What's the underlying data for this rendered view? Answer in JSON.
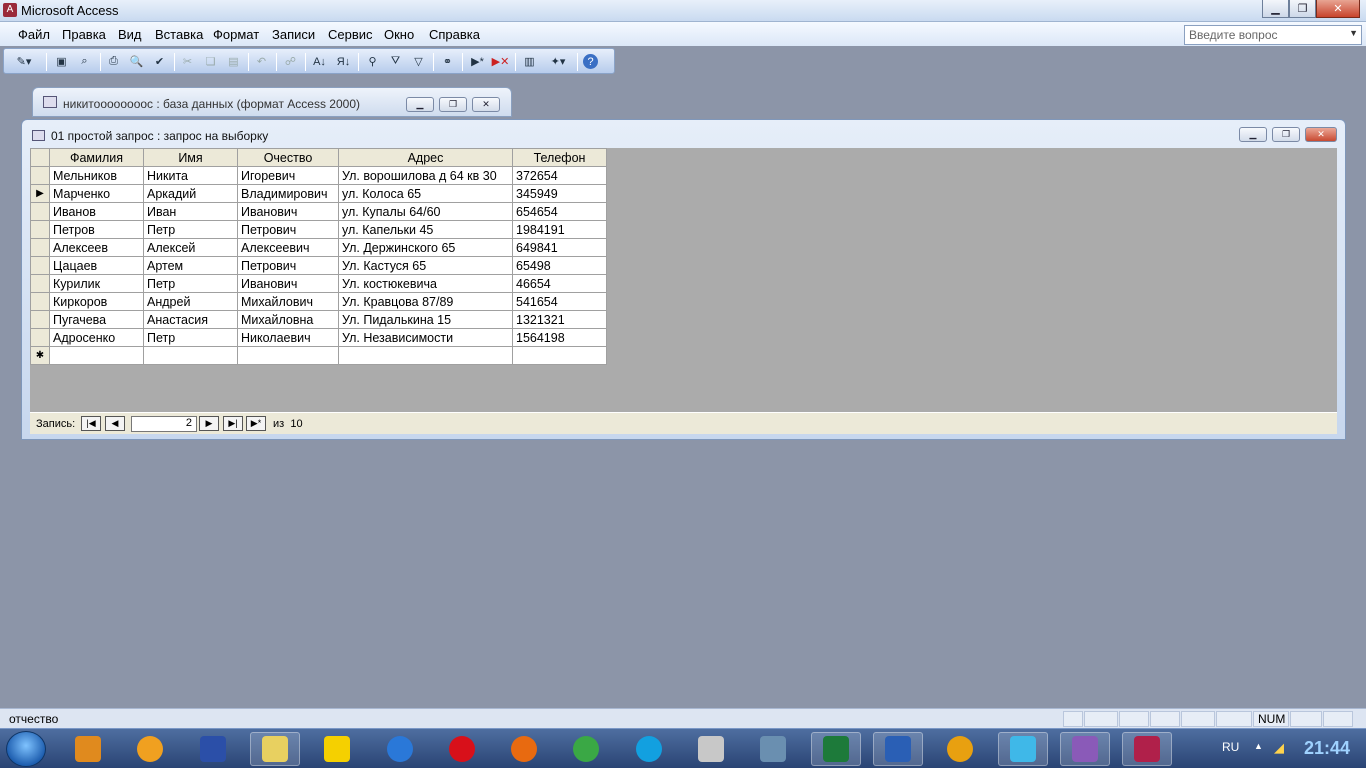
{
  "app": {
    "title": "Microsoft Access"
  },
  "menu": [
    "Файл",
    "Правка",
    "Вид",
    "Вставка",
    "Формат",
    "Записи",
    "Сервис",
    "Окно",
    "Справка"
  ],
  "ask_box": {
    "placeholder": "Введите вопрос"
  },
  "toolbar_icons": [
    "view-icon",
    "save-icon",
    "search-db-icon",
    "print-icon",
    "print-preview-icon",
    "spelling-icon",
    "cut-icon",
    "copy-icon",
    "paste-icon",
    "undo-icon",
    "hyperlink-icon",
    "sort-asc-icon",
    "sort-desc-icon",
    "filter-selection-icon",
    "filter-form-icon",
    "apply-filter-icon",
    "find-icon",
    "new-record-icon",
    "delete-record-icon",
    "database-window-icon",
    "new-object-icon",
    "help-icon"
  ],
  "db_window": {
    "title": "никитоооооооос : база данных (формат Access 2000)"
  },
  "query_window": {
    "title": "01 простой запрос : запрос на выборку"
  },
  "datasheet": {
    "columns": [
      "Фамилия",
      "Имя",
      "Очество",
      "Адрес",
      "Телефон"
    ],
    "rows": [
      [
        "Мельников",
        "Никита",
        "Игоревич",
        "Ул. ворошилова д 64 кв 30",
        "372654"
      ],
      [
        "Марченко",
        "Аркадий",
        "Владимирович",
        "ул. Колоса 65",
        "345949"
      ],
      [
        "Иванов",
        "Иван",
        "Иванович",
        "ул. Купалы 64/60",
        "654654"
      ],
      [
        "Петров",
        "Петр",
        "Петрович",
        "ул. Капельки 45",
        "1984191"
      ],
      [
        "Алексеев",
        "Алексей",
        "Алексеевич",
        "Ул. Держинского 65",
        "649841"
      ],
      [
        "Цацаев",
        "Артем",
        "Петрович",
        "Ул.  Кастуся 65",
        "65498"
      ],
      [
        "Курилик",
        "Петр",
        "Иванович",
        "Ул.  костюкевича",
        "46654"
      ],
      [
        "Киркоров",
        "Андрей",
        "Михайлович",
        "Ул. Кравцова 87/89",
        "541654"
      ],
      [
        "Пугачева",
        "Анастасия",
        "Михайловна",
        "Ул. Пидалькина 15",
        "1321321"
      ],
      [
        "Адросенко",
        "Петр",
        "Николаевич",
        "Ул. Независимости",
        "1564198"
      ]
    ],
    "current_row_index": 1
  },
  "navigator": {
    "label": "Запись:",
    "current": "2",
    "of_label": "из",
    "total": "10"
  },
  "status": {
    "text": "отчество",
    "num": "NUM"
  },
  "taskbar": {
    "apps": [
      "winrar-icon",
      "avast-icon",
      "save-disk-icon",
      "explorer-icon",
      "beeline-icon",
      "ie-icon",
      "opera-icon",
      "firefox-icon",
      "chrome-icon",
      "skype-icon",
      "solitaire-icon",
      "calendar-icon",
      "excel-icon",
      "word-icon",
      "info-icon",
      "vector-icon",
      "onenote-icon",
      "access-icon"
    ],
    "language": "RU",
    "clock": "21:44"
  },
  "colors": {
    "accent": "#1f5fb0",
    "desktop": "#8c95a8",
    "datasheet_bg": "#ababab",
    "header_bg": "#ece9d8"
  }
}
